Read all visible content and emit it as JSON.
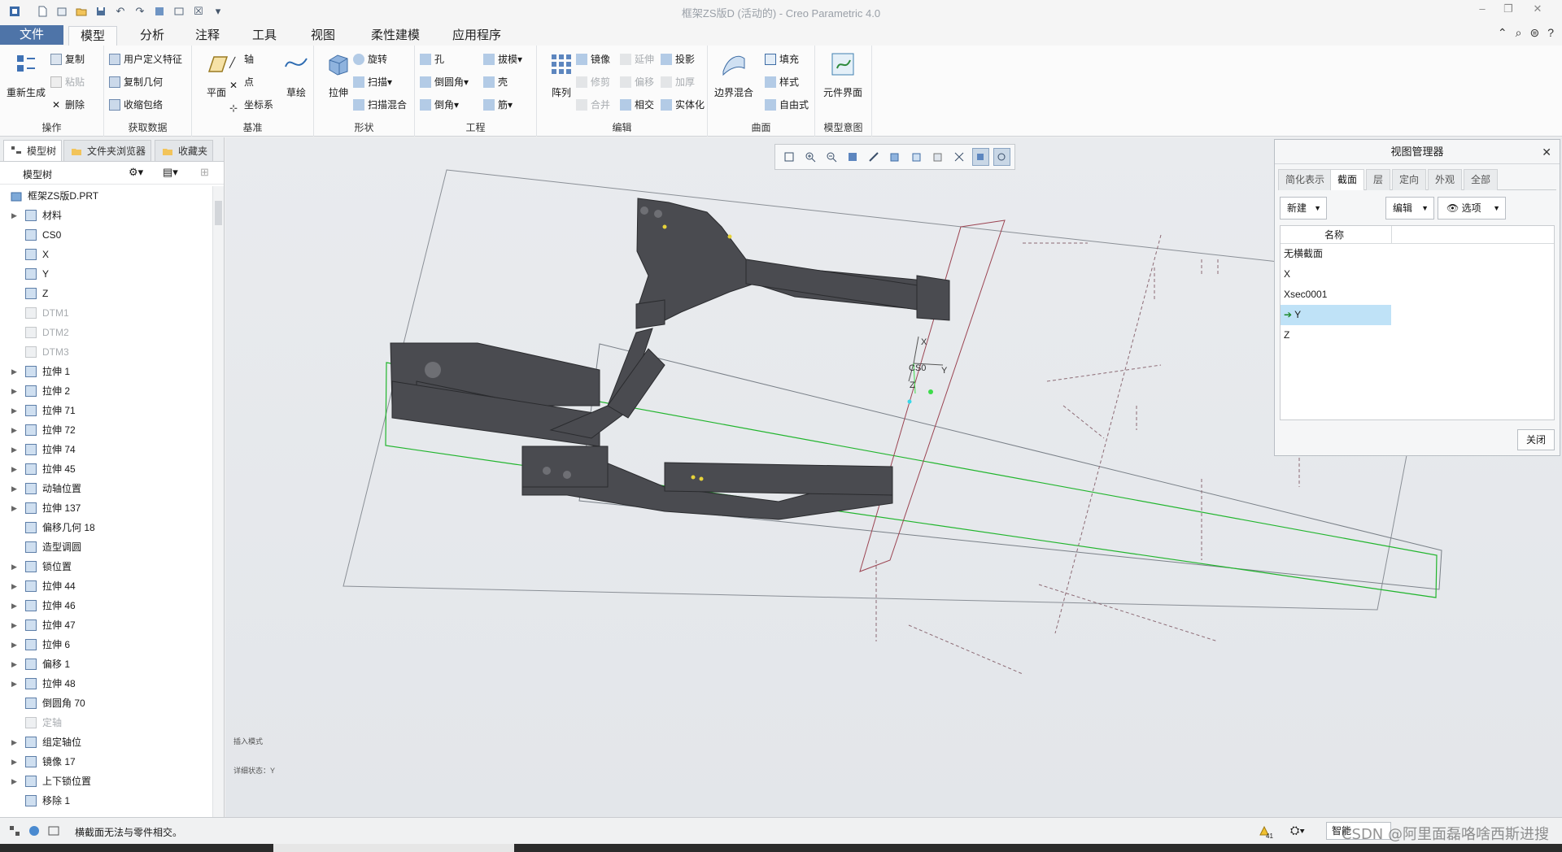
{
  "window": {
    "title": "框架ZS版D (活动的) - Creo Parametric 4.0"
  },
  "ribbon_tabs": [
    "文件",
    "模型",
    "分析",
    "注释",
    "工具",
    "视图",
    "柔性建模",
    "应用程序"
  ],
  "ribbon": {
    "operations": {
      "regenerate": "重新生成",
      "copy": "复制",
      "paste": "粘贴",
      "delete": "删除",
      "label": "操作"
    },
    "getdata": {
      "udf": "用户定义特征",
      "copy_geom": "复制几何",
      "shrinkwrap": "收缩包络",
      "label": "获取数据"
    },
    "datum": {
      "plane": "平面",
      "axis": "轴",
      "point": "点",
      "csys": "坐标系",
      "sketch": "草绘",
      "label": "基准"
    },
    "shapes": {
      "extrude": "拉伸",
      "revolve": "旋转",
      "sweep": "扫描",
      "swept_blend": "扫描混合",
      "label": "形状"
    },
    "engineering": {
      "hole": "孔",
      "round": "倒圆角",
      "chamfer": "倒角",
      "draft": "拔模",
      "shell": "壳",
      "rib": "筋",
      "label": "工程"
    },
    "editing": {
      "pattern": "阵列",
      "mirror": "镜像",
      "trim": "修剪",
      "merge": "合并",
      "extend": "延伸",
      "offset": "偏移",
      "intersect": "相交",
      "project": "投影",
      "thicken": "加厚",
      "solidify": "实体化",
      "label": "编辑"
    },
    "surfaces": {
      "boundary_blend": "边界混合",
      "fill": "填充",
      "style": "样式",
      "freestyle": "自由式",
      "label": "曲面"
    },
    "model_intent": {
      "component_interface": "元件界面",
      "label": "模型意图"
    }
  },
  "panel_tabs": {
    "model_tree": "模型树",
    "folder_browser": "文件夹浏览器",
    "favorites": "收藏夹"
  },
  "model_tree": {
    "header": "模型树",
    "root": "框架ZS版D.PRT",
    "items": [
      {
        "label": "材料",
        "expand": true,
        "dim": false
      },
      {
        "label": "CS0",
        "expand": false,
        "dim": false
      },
      {
        "label": "X",
        "expand": false,
        "dim": false
      },
      {
        "label": "Y",
        "expand": false,
        "dim": false
      },
      {
        "label": "Z",
        "expand": false,
        "dim": false
      },
      {
        "label": "DTM1",
        "expand": false,
        "dim": true
      },
      {
        "label": "DTM2",
        "expand": false,
        "dim": true
      },
      {
        "label": "DTM3",
        "expand": false,
        "dim": true
      },
      {
        "label": "拉伸 1",
        "expand": true,
        "dim": false
      },
      {
        "label": "拉伸 2",
        "expand": true,
        "dim": false
      },
      {
        "label": "拉伸 71",
        "expand": true,
        "dim": false
      },
      {
        "label": "拉伸 72",
        "expand": true,
        "dim": false
      },
      {
        "label": "拉伸 74",
        "expand": true,
        "dim": false
      },
      {
        "label": "拉伸 45",
        "expand": true,
        "dim": false
      },
      {
        "label": "动轴位置",
        "expand": true,
        "dim": false
      },
      {
        "label": "拉伸 137",
        "expand": true,
        "dim": false
      },
      {
        "label": "偏移几何 18",
        "expand": false,
        "dim": false
      },
      {
        "label": "造型调圆",
        "expand": false,
        "dim": false
      },
      {
        "label": "锁位置",
        "expand": true,
        "dim": false
      },
      {
        "label": "拉伸 44",
        "expand": true,
        "dim": false
      },
      {
        "label": "拉伸 46",
        "expand": true,
        "dim": false
      },
      {
        "label": "拉伸 47",
        "expand": true,
        "dim": false
      },
      {
        "label": "拉伸 6",
        "expand": true,
        "dim": false
      },
      {
        "label": "偏移 1",
        "expand": true,
        "dim": false
      },
      {
        "label": "拉伸 48",
        "expand": true,
        "dim": false
      },
      {
        "label": "倒圆角 70",
        "expand": false,
        "dim": false
      },
      {
        "label": "定轴",
        "expand": false,
        "dim": true
      },
      {
        "label": "组定轴位",
        "expand": true,
        "dim": false
      },
      {
        "label": "镜像 17",
        "expand": true,
        "dim": false
      },
      {
        "label": "上下锁位置",
        "expand": true,
        "dim": false
      },
      {
        "label": "移除 1",
        "expand": false,
        "dim": false
      }
    ]
  },
  "view_manager": {
    "title": "视图管理器",
    "tabs": [
      "简化表示",
      "截面",
      "层",
      "定向",
      "外观",
      "全部"
    ],
    "active_tab": "截面",
    "new_label": "新建",
    "edit_label": "编辑",
    "options_label": "选项",
    "column_name": "名称",
    "rows": [
      "无横截面",
      "X",
      "Xsec0001",
      "Y",
      "Z"
    ],
    "selected_row": "Y",
    "close_label": "关闭"
  },
  "viewport": {
    "csys_label": "CS0",
    "axis_x": "X",
    "axis_y": "Y",
    "axis_z": "Z",
    "note1": "插入模式",
    "note2": "详细状态：Y"
  },
  "status": {
    "message": "横截面无法与零件相交。",
    "filter_label": "智能",
    "badge_count": "41"
  },
  "watermark": "CSDN @阿里面磊咯啥西斯进搜"
}
